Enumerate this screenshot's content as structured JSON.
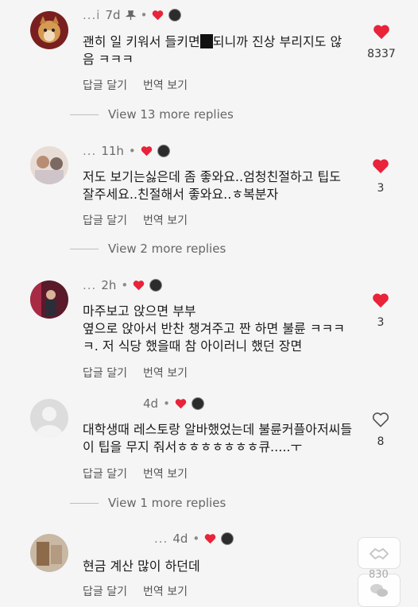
{
  "actions": {
    "reply": "답글 달기",
    "translate": "번역 보기"
  },
  "colors": {
    "heart": "#e8233a",
    "text": "#1c1c1c",
    "muted": "#666666"
  },
  "comments": [
    {
      "user": "...i",
      "time": "7d",
      "pinned": true,
      "text_before": "괜히 일 키워서 들키면",
      "text_after": "되니까 진상 부리지도 않음 ㅋㅋㅋ",
      "likes": "8337",
      "liked": true,
      "replies_label": "View 13 more replies"
    },
    {
      "user": "...",
      "time": "11h",
      "text": "저도 보기는싫은데 좀 좋와요..엄청친절하고 팁도 잘주세요..친절해서 좋와요..ㅎ복분자",
      "likes": "3",
      "liked": true,
      "replies_label": "View 2 more replies"
    },
    {
      "user": "...",
      "time": "2h",
      "text": "마주보고 앉으면 부부\n옆으로 앉아서 반찬 챙겨주고 짠 하면 불륜 ㅋㅋㅋㅋ. 저 식당 했을때 참 아이러니 했던 장면",
      "likes": "3",
      "liked": true
    },
    {
      "user": "",
      "time": "4d",
      "text": "대학생때 레스토랑 알바했었는데 불륜커플아저씨들이 팁을 무지 줘서ㅎㅎㅎㅎㅎㅎㅎ큐.....ㅜ",
      "likes": "8",
      "liked": false,
      "replies_label": "View 1 more replies"
    },
    {
      "user": "...",
      "time": "4d",
      "text": "현금 계산 많이 하던데"
    }
  ],
  "floating": {
    "count": "830"
  }
}
